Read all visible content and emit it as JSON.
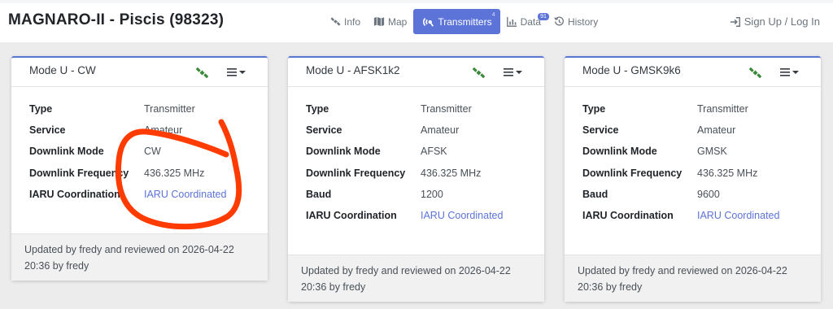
{
  "page": {
    "title": "MAGNARO-II - Piscis (98323)"
  },
  "nav": {
    "info": "Info",
    "map": "Map",
    "transmitters": "Transmitters",
    "transmitters_badge": "4",
    "data": "Data",
    "data_badge": "91",
    "history": "History",
    "login": "Sign Up / Log In"
  },
  "colors": {
    "accent": "#5c73d8",
    "sat_icon": "#3a8a3a",
    "annotation": "#ff3b00"
  },
  "cards": [
    {
      "title": "Mode U - CW",
      "rows": [
        {
          "k": "Type",
          "v": "Transmitter"
        },
        {
          "k": "Service",
          "v": "Amateur"
        },
        {
          "k": "Downlink Mode",
          "v": "CW"
        },
        {
          "k": "Downlink Frequency",
          "v": "436.325 MHz"
        },
        {
          "k": "IARU Coordination",
          "v": "IARU Coordinated"
        }
      ],
      "footer_line1": "Updated by fredy and reviewed on 2026-04-22",
      "footer_line2": "20:36 by fredy"
    },
    {
      "title": "Mode U - AFSK1k2",
      "rows": [
        {
          "k": "Type",
          "v": "Transmitter"
        },
        {
          "k": "Service",
          "v": "Amateur"
        },
        {
          "k": "Downlink Mode",
          "v": "AFSK"
        },
        {
          "k": "Downlink Frequency",
          "v": "436.325 MHz"
        },
        {
          "k": "Baud",
          "v": "1200"
        },
        {
          "k": "IARU Coordination",
          "v": "IARU Coordinated"
        }
      ],
      "footer_line1": "Updated by fredy and reviewed on 2026-04-22",
      "footer_line2": "20:36 by fredy"
    },
    {
      "title": "Mode U - GMSK9k6",
      "rows": [
        {
          "k": "Type",
          "v": "Transmitter"
        },
        {
          "k": "Service",
          "v": "Amateur"
        },
        {
          "k": "Downlink Mode",
          "v": "GMSK"
        },
        {
          "k": "Downlink Frequency",
          "v": "436.325 MHz"
        },
        {
          "k": "Baud",
          "v": "9600"
        },
        {
          "k": "IARU Coordination",
          "v": "IARU Coordinated"
        }
      ],
      "footer_line1": "Updated by fredy and reviewed on 2026-04-22",
      "footer_line2": "20:36 by fredy"
    }
  ]
}
